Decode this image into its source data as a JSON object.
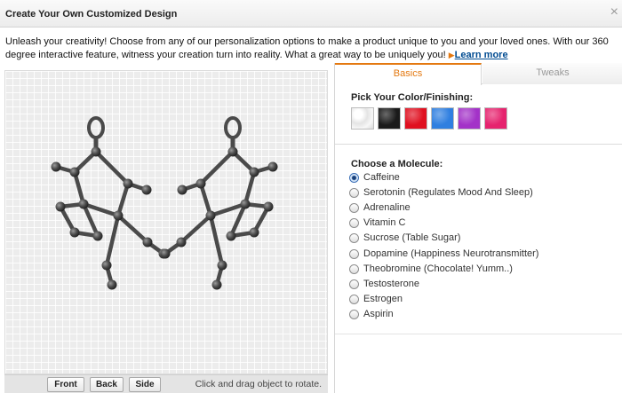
{
  "dialog": {
    "title": "Create Your Own Customized Design",
    "close_glyph": "×",
    "intro_text": "Unleash your creativity! Choose from any of our personalization options to make a product unique to you and your loved ones. With our 360 degree interactive feature, witness your creation turn into reality. What a great way to be uniquely you! ",
    "learn_more_arrow": "▶",
    "learn_more_label": "Learn more"
  },
  "viewer": {
    "background": "grid",
    "object_color": "#4a4a4a",
    "buttons": [
      {
        "label": "Front"
      },
      {
        "label": "Back"
      },
      {
        "label": "Side"
      }
    ],
    "hint": "Click and drag object to rotate."
  },
  "tabs": [
    {
      "label": "Basics",
      "active": true
    },
    {
      "label": "Tweaks",
      "active": false
    }
  ],
  "color_section": {
    "title": "Pick Your Color/Finishing:",
    "swatches": [
      {
        "name": "white-glitter",
        "color": "#f2f2f2"
      },
      {
        "name": "black",
        "color": "#1a1a1a"
      },
      {
        "name": "red",
        "color": "#e01020"
      },
      {
        "name": "blue",
        "color": "#2f7fe0"
      },
      {
        "name": "purple",
        "color": "#a332c8"
      },
      {
        "name": "pink",
        "color": "#e6236e"
      }
    ]
  },
  "molecule_section": {
    "title": "Choose a Molecule:",
    "selected": "Caffeine",
    "options": [
      "Caffeine",
      "Serotonin (Regulates Mood And Sleep)",
      "Adrenaline",
      "Vitamin C",
      "Sucrose (Table Sugar)",
      "Dopamine (Happiness Neurotransmitter)",
      "Theobromine (Chocolate! Yumm..)",
      "Testosterone",
      "Estrogen",
      "Aspirin"
    ]
  },
  "colors": {
    "accent": "#e47911",
    "link": "#004b91"
  }
}
